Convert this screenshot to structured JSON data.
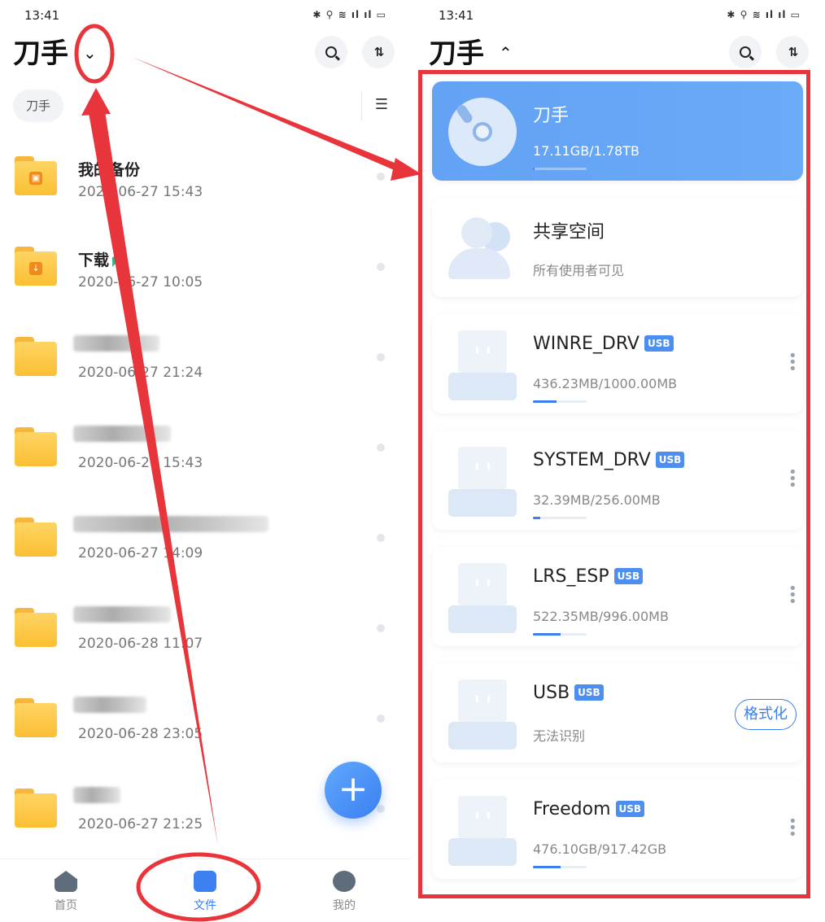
{
  "status": {
    "time": "13:41",
    "icons": "✱ ⚲ ≋ ıl ıl ▭"
  },
  "left": {
    "title": "刀手",
    "chevron": "⌄",
    "chip": "刀手",
    "files": [
      {
        "name": "我的备份",
        "date": "2020-06-27  15:43",
        "badge": "▣",
        "blurred": false
      },
      {
        "name": "下载",
        "date": "2020-06-27  10:05",
        "badge": "↓",
        "blurred": false,
        "send": "◤"
      },
      {
        "name": "",
        "date": "2020-06-27  21:24",
        "blurred": true
      },
      {
        "name": "",
        "date": "2020-06-27  15:43",
        "blurred": true
      },
      {
        "name": "",
        "date": "2020-06-27  14:09",
        "blurred": true
      },
      {
        "name": "",
        "date": "2020-06-28  11:07",
        "blurred": true
      },
      {
        "name": "",
        "date": "2020-06-28  23:05",
        "blurred": true
      },
      {
        "name": "",
        "date": "2020-06-27  21:25",
        "blurred": true
      }
    ],
    "fab": "+",
    "tabs": {
      "home": "首页",
      "files": "文件",
      "me": "我的"
    }
  },
  "right": {
    "title": "刀手",
    "chevron": "⌃",
    "drives": [
      {
        "name": "刀手",
        "info": "17.11GB/1.78TB",
        "type": "disc",
        "usb": false,
        "progress": 0.01
      },
      {
        "name": "共享空间",
        "info": "所有使用者可见",
        "type": "people",
        "usb": false
      },
      {
        "name": "WINRE_DRV",
        "info": "436.23MB/1000.00MB",
        "type": "usb",
        "usb": true,
        "progress": 0.44
      },
      {
        "name": "SYSTEM_DRV",
        "info": "32.39MB/256.00MB",
        "type": "usb",
        "usb": true,
        "progress": 0.13
      },
      {
        "name": "LRS_ESP",
        "info": "522.35MB/996.00MB",
        "type": "usb",
        "usb": true,
        "progress": 0.52
      },
      {
        "name": "USB",
        "info": "无法识别",
        "type": "usb",
        "usb": true,
        "format": "格式化"
      },
      {
        "name": "Freedom",
        "info": "476.10GB/917.42GB",
        "type": "usb",
        "usb": true,
        "progress": 0.52
      }
    ],
    "usb_tag": "USB"
  },
  "colors": {
    "accent": "#3b7ff0",
    "annotation": "#e8353b"
  }
}
